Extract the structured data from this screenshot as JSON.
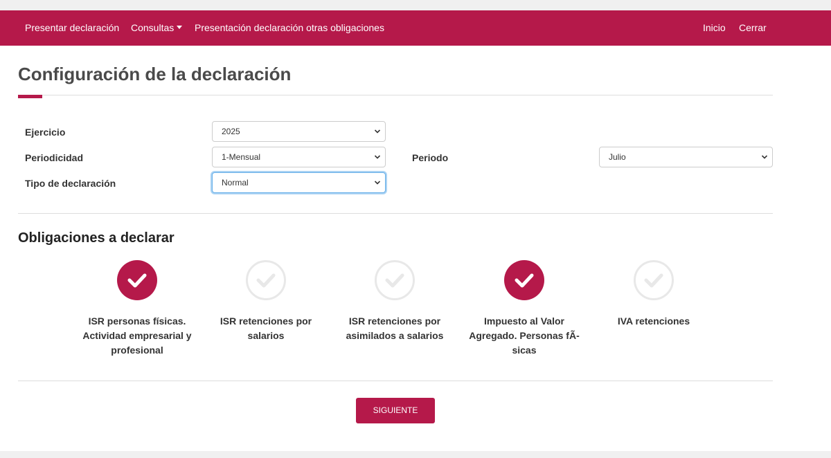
{
  "colors": {
    "brand": "#b5194a",
    "check_off": "#e8e8e8",
    "focus": "#66afe9"
  },
  "nav": {
    "left_items": [
      "Presentar declaración",
      "Consultas",
      "Presentación declaración otras obligaciones"
    ],
    "right_items": [
      "Inicio",
      "Cerrar"
    ]
  },
  "page": {
    "title": "Configuración de la declaración"
  },
  "form": {
    "ejercicio": {
      "label": "Ejercicio",
      "value": "2025"
    },
    "periodicidad": {
      "label": "Periodicidad",
      "value": "1-Mensual"
    },
    "periodo": {
      "label": "Periodo",
      "value": "Julio"
    },
    "tipo": {
      "label": "Tipo de declaración",
      "value": "Normal"
    }
  },
  "obligations": {
    "title": "Obligaciones a declarar",
    "items": [
      {
        "label": "ISR personas físicas. Actividad empresarial y profesional",
        "checked": true,
        "icon": "check-icon"
      },
      {
        "label": "ISR retenciones por salarios",
        "checked": false,
        "icon": "check-icon"
      },
      {
        "label": "ISR retenciones por asimilados a salarios",
        "checked": false,
        "icon": "check-icon"
      },
      {
        "label": "Impuesto al Valor Agregado. Personas fÃ-sicas",
        "checked": true,
        "icon": "check-icon"
      },
      {
        "label": "IVA retenciones",
        "checked": false,
        "icon": "check-icon"
      }
    ]
  },
  "actions": {
    "next_label": "SIGUIENTE"
  }
}
